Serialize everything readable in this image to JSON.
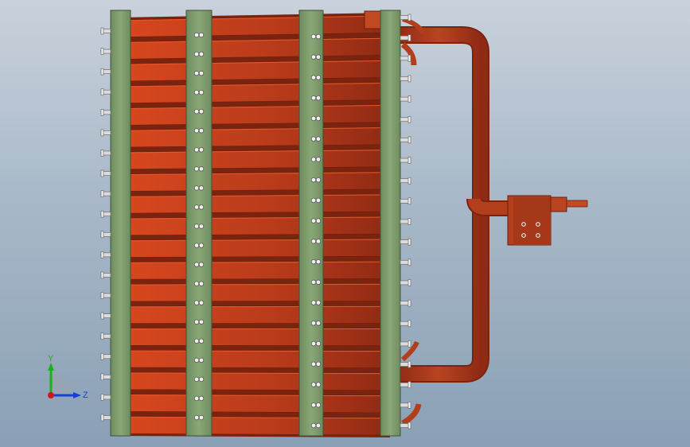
{
  "viewport": {
    "background_top": "#c9d2dc",
    "background_bottom": "#8aa0b6"
  },
  "model": {
    "fin_color": "#c8401e",
    "fin_dark": "#8f2a14",
    "tube_plate_color": "#7f9e6c",
    "tube_plate_edge": "#3e5236",
    "pipe_color": "#a83a1c",
    "bolt_color": "#e6e6e6",
    "fin_count": 19,
    "tube_plates": 4
  },
  "triad": {
    "y_label": "Y",
    "z_label": "Z",
    "y_color": "#19b019",
    "z_color": "#1a3fd6",
    "origin_color": "#d01818"
  }
}
